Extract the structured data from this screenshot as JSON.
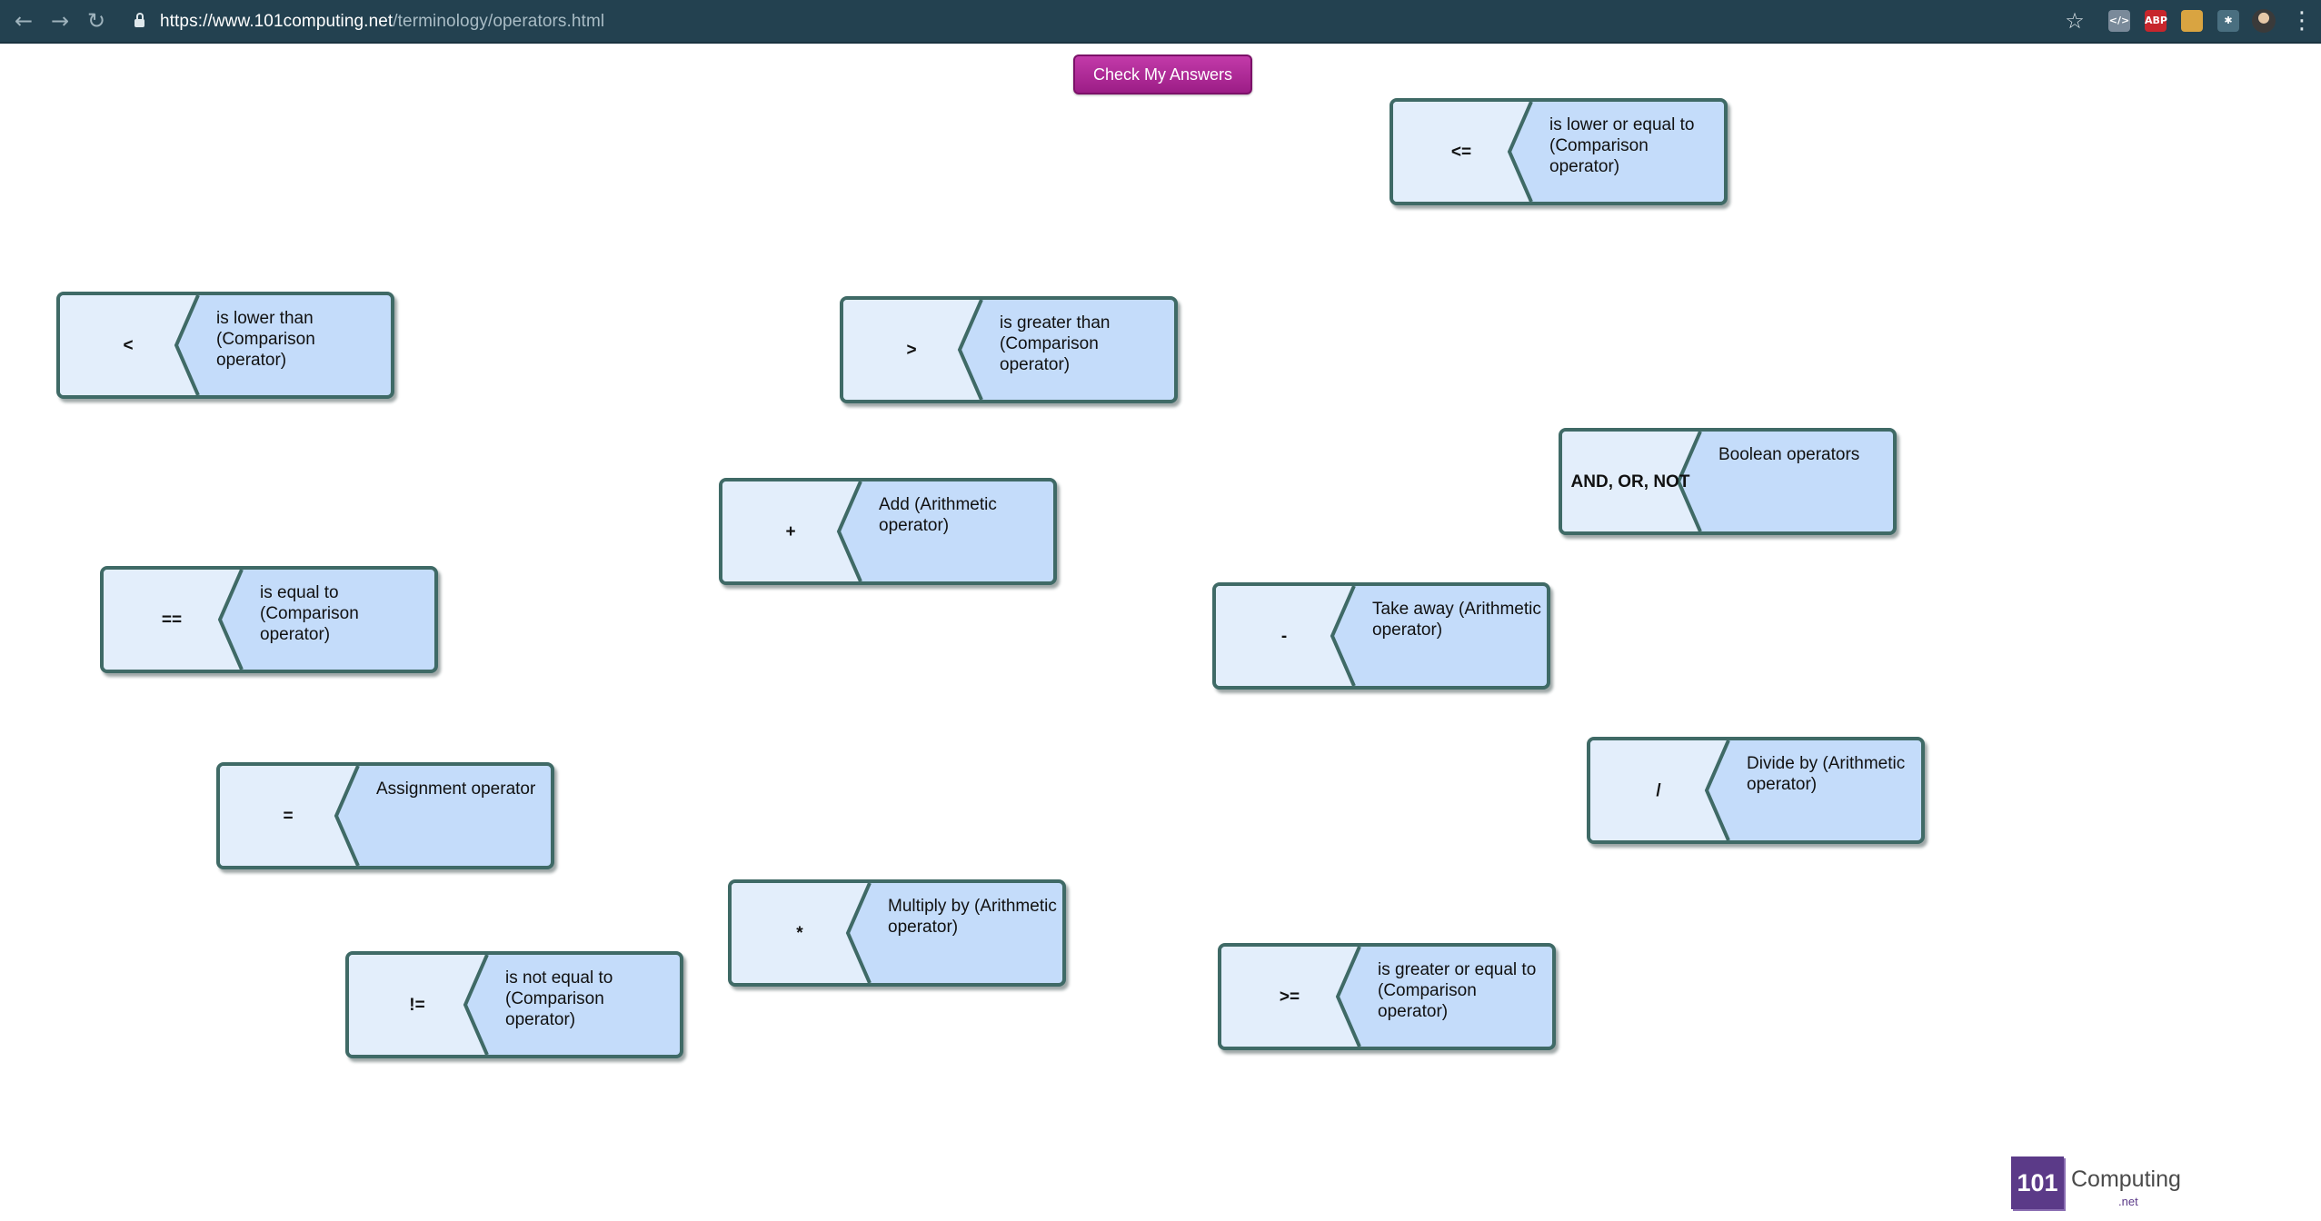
{
  "browser": {
    "url_host": "https://www.101computing.net",
    "url_path": "/terminology/operators.html",
    "back_icon": "←",
    "forward_icon": "→",
    "reload_icon": "↻",
    "star_icon": "☆",
    "menu_icon": "⋮",
    "extensions": [
      {
        "name": "code-extension-icon",
        "label": "</>",
        "color": "#7a8a9a"
      },
      {
        "name": "adblock-icon",
        "label": "ABP",
        "color": "#c7262c"
      },
      {
        "name": "extension-3-icon",
        "label": "",
        "color": "#d9a441"
      },
      {
        "name": "puzzle-icon",
        "label": "✱",
        "color": "#4a6f80"
      }
    ]
  },
  "page": {
    "check_button": "Check My Answers",
    "cards": [
      {
        "symbol": "<=",
        "description": "is lower or equal to (Comparison operator)"
      },
      {
        "symbol": "<",
        "description": "is lower than (Comparison operator)"
      },
      {
        "symbol": ">",
        "description": "is greater than (Comparison operator)"
      },
      {
        "symbol": "AND, OR, NOT",
        "description": "Boolean operators"
      },
      {
        "symbol": "+",
        "description": "Add (Arithmetic operator)"
      },
      {
        "symbol": "==",
        "description": "is equal to (Comparison operator)"
      },
      {
        "symbol": "-",
        "description": "Take away (Arithmetic operator)"
      },
      {
        "symbol": "/",
        "description": "Divide by (Arithmetic operator)"
      },
      {
        "symbol": "=",
        "description": "Assignment operator"
      },
      {
        "symbol": "*",
        "description": "Multiply by (Arithmetic operator)"
      },
      {
        "symbol": ">=",
        "description": "is greater or equal to (Comparison operator)"
      },
      {
        "symbol": "!=",
        "description": "is not equal to (Comparison operator)"
      }
    ]
  },
  "logo": {
    "number": "101",
    "word": "Computing",
    "suffix": ".net"
  }
}
